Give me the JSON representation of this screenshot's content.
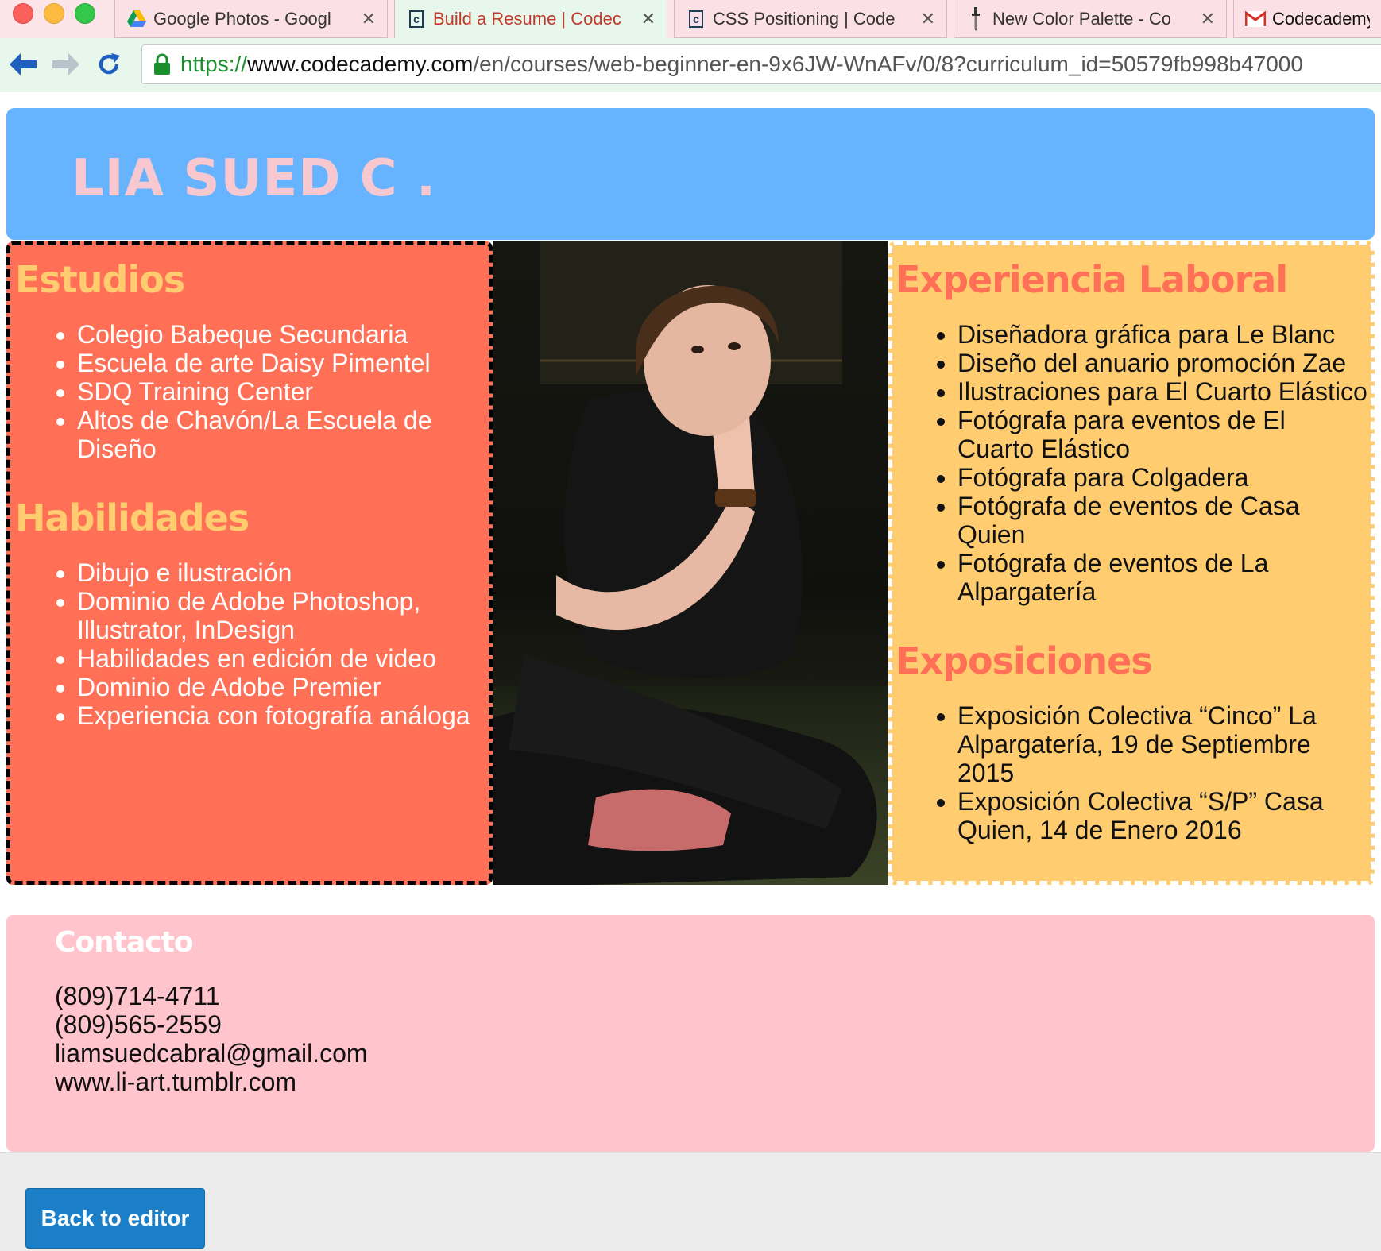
{
  "browser": {
    "tabs": [
      {
        "title": "Google Photos - Googl",
        "icon": "google-drive-icon",
        "active": false
      },
      {
        "title": "Build a Resume | Codec",
        "icon": "codecademy-icon",
        "active": true
      },
      {
        "title": "CSS Positioning | Code",
        "icon": "codecademy-icon",
        "active": false
      },
      {
        "title": "New Color Palette - Co",
        "icon": "eyedropper-icon",
        "active": false
      },
      {
        "title": "Codecademy!",
        "icon": "gmail-icon",
        "active": false
      }
    ],
    "close_glyph": "✕",
    "url": {
      "scheme": "https://",
      "host": "www.codecademy.com",
      "path": "/en/courses/web-beginner-en-9x6JW-WnAFv/0/8?curriculum_id=50579fb998b47000"
    }
  },
  "resume": {
    "name": "LIA SUED C .",
    "estudios": {
      "title": "Estudios",
      "items": [
        "Colegio Babeque Secundaria",
        "Escuela de arte Daisy Pimentel",
        "SDQ Training Center",
        "Altos de Chavón/La Escuela de Diseño"
      ]
    },
    "habilidades": {
      "title": "Habilidades",
      "items": [
        "Dibujo e ilustración",
        "Dominio de Adobe Photoshop, Illustrator, InDesign",
        "Habilidades en edición de video",
        "Dominio de Adobe Premier",
        "Experiencia con fotografía análoga"
      ]
    },
    "experiencia": {
      "title": "Experiencia Laboral",
      "items": [
        "Diseñadora gráfica para Le Blanc",
        "Diseño del anuario promoción Zae",
        "Ilustraciones para El Cuarto Elástico",
        "Fotógrafa para eventos de El Cuarto Elástico",
        "Fotógrafa para Colgadera",
        "Fotógrafa de eventos de Casa Quien",
        "Fotógrafa de eventos de La Alpargatería"
      ]
    },
    "exposiciones": {
      "title": "Exposiciones",
      "items": [
        "Exposición Colectiva “Cinco” La Alpargatería, 19 de Septiembre 2015",
        "Exposición Colectiva “S/P” Casa Quien, 14 de Enero 2016"
      ]
    },
    "contacto": {
      "title": "Contacto",
      "phone1": "(809)714-4711",
      "phone2": "(809)565-2559",
      "email": "liamsuedcabral@gmail.com",
      "website": "www.li-art.tumblr.com"
    }
  },
  "footer": {
    "back_button": "Back to editor"
  },
  "colors": {
    "header_bg": "#66b3ff",
    "name_color": "#f7c8d0",
    "left_bg": "#ff7057",
    "right_bg": "#ffcc70",
    "contact_bg": "#ffc4cc",
    "button_bg": "#1a7fc6"
  }
}
